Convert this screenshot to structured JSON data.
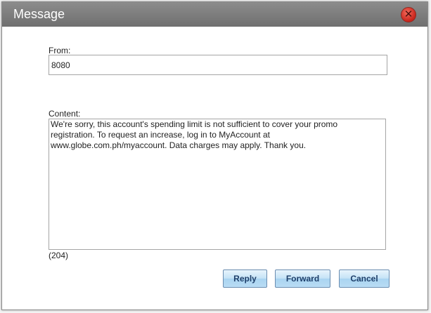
{
  "dialog": {
    "title": "Message",
    "close_glyph": "✕"
  },
  "from": {
    "label": "From:",
    "value": "8080"
  },
  "content": {
    "label": "Content:",
    "value": "We're sorry, this account's spending limit is not sufficient to cover your promo registration. To request an increase, log in to MyAccount at www.globe.com.ph/myaccount. Data charges may apply. Thank you.",
    "char_count": "(204)"
  },
  "buttons": {
    "reply": "Reply",
    "forward": "Forward",
    "cancel": "Cancel"
  },
  "colors": {
    "titlebar": "#7d7d7d",
    "close_button": "#d8352a",
    "button_text": "#1e3f6a"
  },
  "icons": {
    "close": "close-icon"
  }
}
